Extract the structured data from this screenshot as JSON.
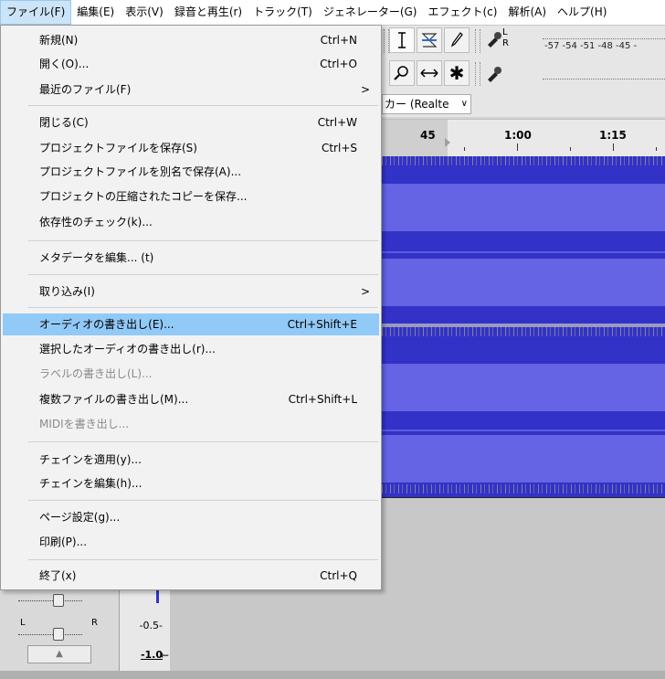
{
  "menubar": {
    "items": [
      "ファイル(F)",
      "編集(E)",
      "表示(V)",
      "録音と再生(r)",
      "トラック(T)",
      "ジェネレーター(G)",
      "エフェクト(c)",
      "解析(A)",
      "ヘルプ(H)"
    ]
  },
  "toolbar": {
    "meter_ticks": "-57 -54 -51 -48 -45 -",
    "meter_rec_label": "L",
    "meter_rec_label2": "R",
    "icons": [
      "select-tool",
      "envelope-tool",
      "draw-tool",
      "record-meter",
      "zoom-tool",
      "timeshift-tool",
      "multi-tool",
      "playback-meter"
    ]
  },
  "device": {
    "output_label": "カー (Realte"
  },
  "timeline": {
    "labels": [
      "45",
      "1:00",
      "1:15"
    ]
  },
  "file_menu": {
    "items": [
      {
        "label": "新規(N)",
        "shortcut": "Ctrl+N"
      },
      {
        "label": "開く(O)...",
        "shortcut": "Ctrl+O"
      },
      {
        "label": "最近のファイル(F)",
        "submenu": true
      },
      {
        "label": "閉じる(C)",
        "shortcut": "Ctrl+W"
      },
      {
        "label": "プロジェクトファイルを保存(S)",
        "shortcut": "Ctrl+S"
      },
      {
        "label": "プロジェクトファイルを別名で保存(A)..."
      },
      {
        "label": "プロジェクトの圧縮されたコピーを保存..."
      },
      {
        "label": "依存性のチェック(k)..."
      },
      {
        "label": "メタデータを編集... (t)"
      },
      {
        "label": "取り込み(I)",
        "submenu": true
      },
      {
        "label": "オーディオの書き出し(E)...",
        "shortcut": "Ctrl+Shift+E",
        "highlighted": true
      },
      {
        "label": "選択したオーディオの書き出し(r)..."
      },
      {
        "label": "ラベルの書き出し(L)...",
        "disabled": true
      },
      {
        "label": "複数ファイルの書き出し(M)...",
        "shortcut": "Ctrl+Shift+L"
      },
      {
        "label": "MIDIを書き出し...",
        "disabled": true
      },
      {
        "label": "チェインを適用(y)..."
      },
      {
        "label": "チェインを編集(h)..."
      },
      {
        "label": "ページ設定(g)..."
      },
      {
        "label": "印刷(P)..."
      },
      {
        "label": "終了(x)",
        "shortcut": "Ctrl+Q"
      }
    ]
  },
  "track_panel": {
    "pan_left": "L",
    "pan_right": "R",
    "ruler_labels": [
      "-0.5-",
      "-1.0"
    ]
  },
  "colors": {
    "menu_highlight": "#91c9f7",
    "waveform": "#3232c8",
    "waveform_rms": "#6464e4"
  }
}
